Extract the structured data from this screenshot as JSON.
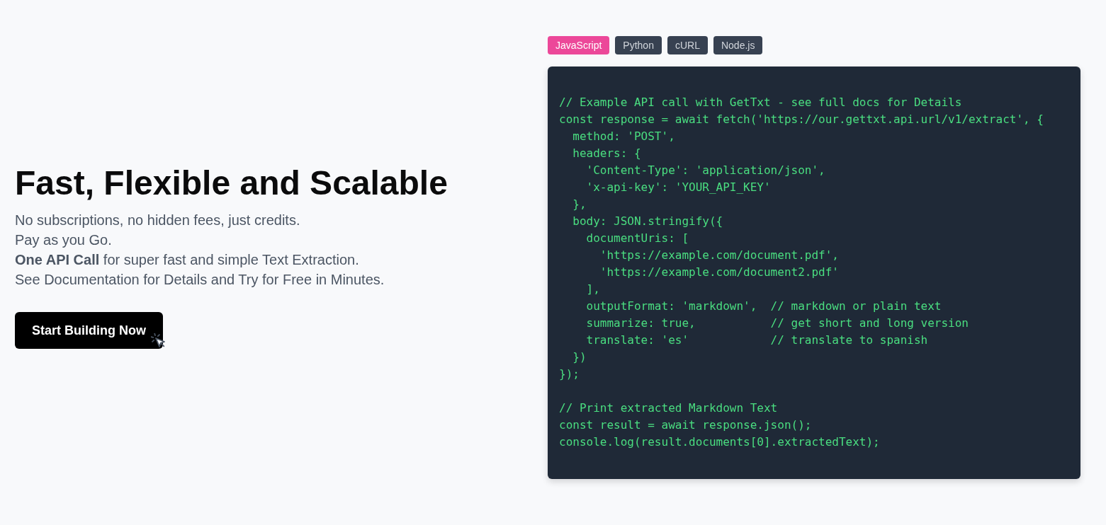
{
  "hero": {
    "title": "Fast, Flexible and Scalable",
    "lines": [
      "No subscriptions, no hidden fees, just credits.",
      "Pay as you Go.",
      "**One API Call** for super fast and simple Text Extraction.",
      "See Documentation for Details and Try for Free in Minutes."
    ],
    "button": "Start Building Now"
  },
  "code_tabs": [
    {
      "label": "JavaScript",
      "selected": true
    },
    {
      "label": "Python",
      "selected": false
    },
    {
      "label": "cURL",
      "selected": false
    },
    {
      "label": "Node.js",
      "selected": false
    }
  ],
  "code_sample": {
    "sections": [
      {
        "lines": [
          "// Example API call with GetTxt - see full docs for Details",
          "const response = await fetch('https://our.gettxt.api.url/v1/extract', {",
          "  method: 'POST',",
          "  headers: {",
          "    'Content-Type': 'application/json',",
          "    'x-api-key': 'YOUR_API_KEY'",
          "  },",
          "  body: JSON.stringify({",
          "    documentUris: [",
          "      'https://example.com/document.pdf',",
          "      'https://example.com/document2.pdf'",
          "    ],",
          "    outputFormat: 'markdown',  // markdown or plain text",
          "    summarize: true,           // get short and long version",
          "    translate: 'es'            // translate to spanish",
          "  })",
          "});"
        ]
      },
      {
        "lines": [
          "// Print extracted Markdown Text",
          "const result = await response.json();",
          "console.log(result.documents[0].extractedText);"
        ]
      }
    ]
  }
}
